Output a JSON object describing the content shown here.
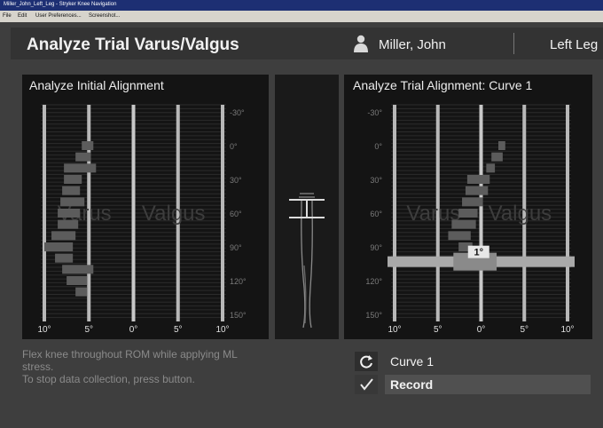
{
  "window": {
    "title": "Miller_John_Left_Leg - Stryker Knee Navigation"
  },
  "menu": {
    "items": [
      "File",
      "Edit",
      "User Preferences...",
      "Screenshot..."
    ]
  },
  "header": {
    "title": "Analyze Trial Varus/Valgus",
    "patient_name": "Miller, John",
    "leg_side": "Left Leg"
  },
  "left_panel": {
    "title": "Analyze Initial Alignment",
    "watermark_left": "Varus",
    "watermark_right": "Valgus",
    "flexion_labels": [
      "-30°",
      "0°",
      "30°",
      "60°",
      "90°",
      "120°",
      "150°"
    ],
    "x_labels": [
      "10°",
      "5°",
      "0°",
      "5°",
      "10°"
    ]
  },
  "right_panel": {
    "title": "Analyze Trial Alignment: Curve 1",
    "watermark_left": "Varus",
    "watermark_right": "Valgus",
    "flexion_labels": [
      "-30°",
      "0°",
      "30°",
      "60°",
      "90°",
      "120°",
      "150°"
    ],
    "x_labels": [
      "10°",
      "5°",
      "0°",
      "5°",
      "10°"
    ],
    "readout": "1°"
  },
  "chart_data": [
    {
      "type": "bar",
      "title": "Analyze Initial Alignment",
      "xlim": [
        10,
        -10
      ],
      "ylim": [
        -30,
        150
      ],
      "description_units": "x = varus(+)/valgus(-) degrees, y = knee flexion degrees",
      "bins": [
        {
          "flexion": 0,
          "from": 5.8,
          "to": 4.5
        },
        {
          "flexion": 10,
          "from": 6.5,
          "to": 4.8
        },
        {
          "flexion": 20,
          "from": 7.8,
          "to": 4.2
        },
        {
          "flexion": 30,
          "from": 7.8,
          "to": 5.8
        },
        {
          "flexion": 40,
          "from": 8.0,
          "to": 6.0
        },
        {
          "flexion": 50,
          "from": 8.2,
          "to": 5.5
        },
        {
          "flexion": 60,
          "from": 8.5,
          "to": 6.0
        },
        {
          "flexion": 70,
          "from": 8.5,
          "to": 6.2
        },
        {
          "flexion": 80,
          "from": 9.2,
          "to": 6.5
        },
        {
          "flexion": 90,
          "from": 10.0,
          "to": 6.8
        },
        {
          "flexion": 100,
          "from": 8.8,
          "to": 6.8
        },
        {
          "flexion": 110,
          "from": 8.0,
          "to": 4.5
        },
        {
          "flexion": 120,
          "from": 7.5,
          "to": 5.2
        },
        {
          "flexion": 130,
          "from": 6.5,
          "to": 5.2
        }
      ]
    },
    {
      "type": "bar",
      "title": "Analyze Trial Alignment: Curve 1",
      "xlim": [
        10,
        -10
      ],
      "ylim": [
        -30,
        150
      ],
      "description_units": "x = varus(+)/valgus(-) degrees, y = knee flexion degrees",
      "bins": [
        {
          "flexion": 0,
          "from": -2.0,
          "to": -2.8
        },
        {
          "flexion": 10,
          "from": -1.2,
          "to": -2.5
        },
        {
          "flexion": 20,
          "from": -0.6,
          "to": -1.6
        },
        {
          "flexion": 30,
          "from": 1.6,
          "to": -1.0
        },
        {
          "flexion": 40,
          "from": 1.8,
          "to": -0.8
        },
        {
          "flexion": 50,
          "from": 2.2,
          "to": -0.2
        },
        {
          "flexion": 60,
          "from": 2.6,
          "to": 0.4
        },
        {
          "flexion": 70,
          "from": 3.4,
          "to": 0.6
        },
        {
          "flexion": 80,
          "from": 3.8,
          "to": 1.2
        },
        {
          "flexion": 90,
          "from": 2.6,
          "to": 1.0
        }
      ],
      "current": {
        "flexion": 100,
        "value": 1
      }
    }
  ],
  "instruction": {
    "line1": "Flex knee throughout ROM while applying ML",
    "line2": "stress.",
    "line3": "To stop data collection, press button."
  },
  "actions": {
    "curve_label": "Curve 1",
    "record_label": "Record"
  },
  "colors": {
    "background": "#3e3e3e",
    "panel": "#141414",
    "bars": "#5a5a5a",
    "gridline": "#c9c9c9",
    "titlebar": "#1d2f73"
  }
}
